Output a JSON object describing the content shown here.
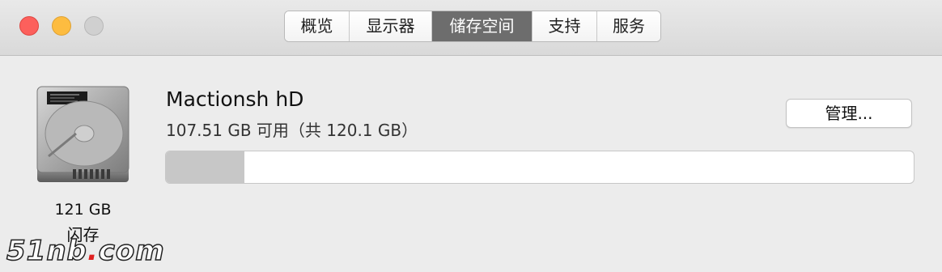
{
  "window": {
    "controls": [
      "close",
      "minimize",
      "zoom"
    ]
  },
  "tabs": [
    {
      "label": "概览",
      "active": false
    },
    {
      "label": "显示器",
      "active": false
    },
    {
      "label": "储存空间",
      "active": true
    },
    {
      "label": "支持",
      "active": false
    },
    {
      "label": "服务",
      "active": false
    }
  ],
  "disk": {
    "icon": "hard-drive-icon",
    "size": "121 GB",
    "type": "闪存"
  },
  "volume": {
    "name": "Mactionsh hD",
    "availability": "107.51 GB 可用（共 120.1 GB）",
    "used_fraction": 0.105
  },
  "manage_button": {
    "label": "管理..."
  },
  "watermark": {
    "text": "51nb",
    "dot": ".",
    "suffix": "com"
  },
  "colors": {
    "close": "#fc605c",
    "minimize": "#fdbc40",
    "zoom_disabled": "#d0d0d0",
    "active_tab": "#6d6d6d",
    "usage_fill": "#c7c7c7"
  }
}
